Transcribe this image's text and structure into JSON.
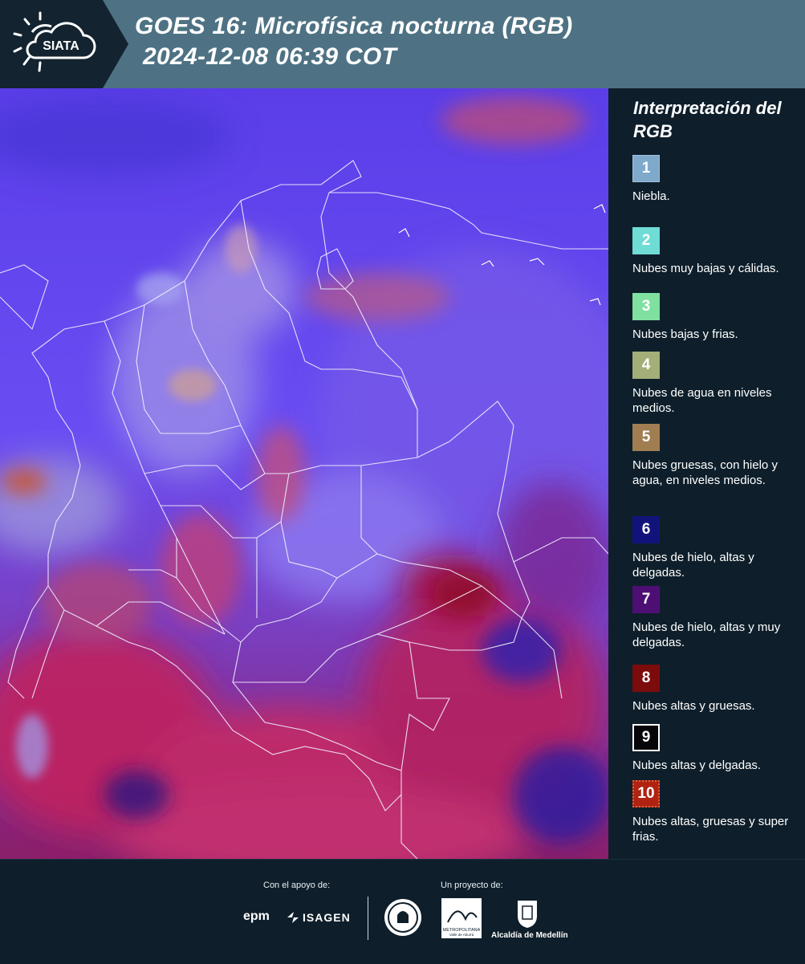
{
  "header": {
    "logo_text": "SIATA",
    "title_line1": "GOES 16: Microfísica nocturna (RGB)",
    "title_line2": "2024-12-08 06:39 COT"
  },
  "legend": {
    "title": "Interpretación del RGB",
    "items": [
      {
        "number": "1",
        "label": "Niebla.",
        "color": "#7fa9cb"
      },
      {
        "number": "2",
        "label": "Nubes muy bajas y cálidas.",
        "color": "#6fdcd6"
      },
      {
        "number": "3",
        "label": "Nubes bajas y frias.",
        "color": "#7fe0a0"
      },
      {
        "number": "4",
        "label": "Nubes de agua en niveles medios.",
        "color": "#a3ae78"
      },
      {
        "number": "5",
        "label": "Nubes gruesas, con hielo y agua, en niveles medios.",
        "color": "#a07e52"
      },
      {
        "number": "6",
        "label": "Nubes de hielo, altas y delgadas.",
        "color": "#12137a"
      },
      {
        "number": "7",
        "label": "Nubes de hielo, altas y muy delgadas.",
        "color": "#4e0f74"
      },
      {
        "number": "8",
        "label": "Nubes altas y gruesas.",
        "color": "#7c0c0c"
      },
      {
        "number": "9",
        "label": "Nubes altas y delgadas.",
        "color": "#05050a"
      },
      {
        "number": "10",
        "label": "Nubes altas, gruesas y super frias.",
        "color": "#b02212"
      }
    ]
  },
  "footer": {
    "support_label": "Con el apoyo de:",
    "project_label": "Un proyecto de:",
    "brand_epm": "epm",
    "brand_isagen": "ISAGEN",
    "metro_label": "METROPOLITANA",
    "metro_sub": "Valle de Aburrá",
    "alcaldia_label": "Alcaldía de Medellín"
  }
}
